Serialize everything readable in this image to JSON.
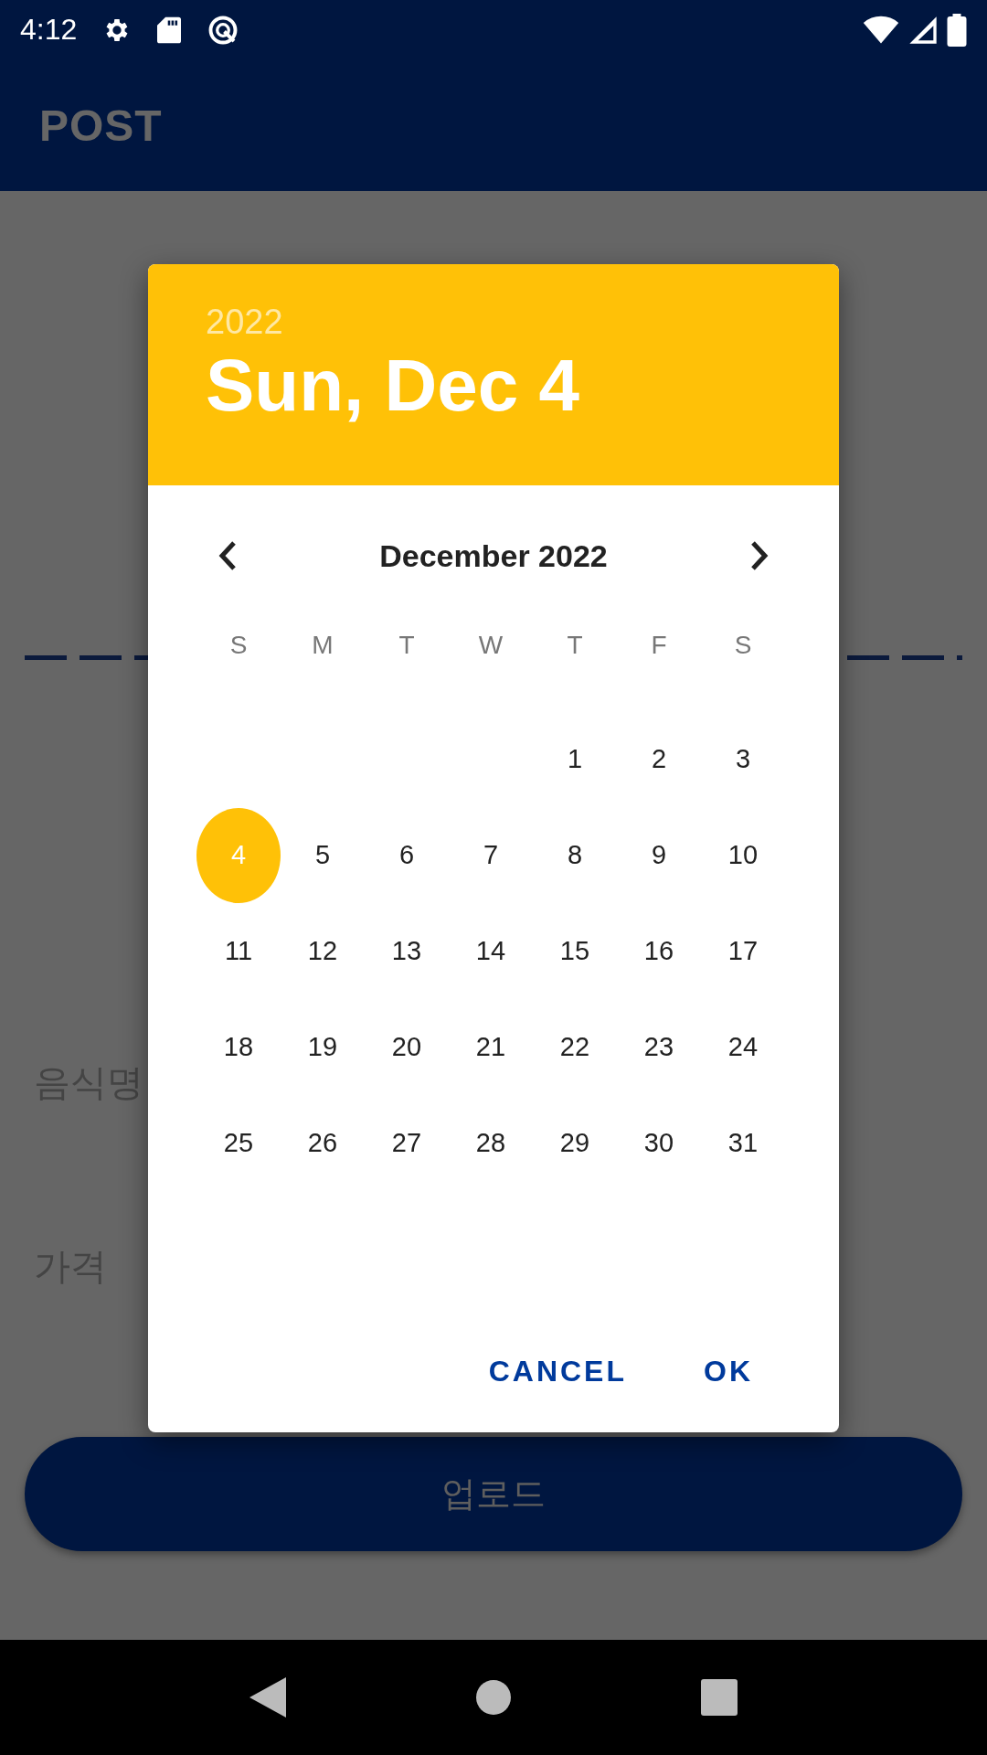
{
  "status_bar": {
    "time": "4:12"
  },
  "app_bar": {
    "title": "POST"
  },
  "form": {
    "labels": [
      "음식명",
      "가격"
    ],
    "submit_button": "업로드"
  },
  "date_picker": {
    "year": "2022",
    "date": "Sun, Dec 4",
    "month": "December 2022",
    "weekdays": [
      "S",
      "M",
      "T",
      "W",
      "T",
      "F",
      "S"
    ],
    "weeks": [
      [
        {
          "kind": "blank"
        },
        {
          "kind": "blank"
        },
        {
          "kind": "blank"
        },
        {
          "kind": "blank"
        },
        {
          "kind": "day",
          "label": "1",
          "selected": false
        },
        {
          "kind": "day",
          "label": "2",
          "selected": false
        },
        {
          "kind": "day",
          "label": "3",
          "selected": false
        }
      ],
      [
        {
          "kind": "day",
          "label": "4",
          "selected": true
        },
        {
          "kind": "day",
          "label": "5",
          "selected": false
        },
        {
          "kind": "day",
          "label": "6",
          "selected": false
        },
        {
          "kind": "day",
          "label": "7",
          "selected": false
        },
        {
          "kind": "day",
          "label": "8",
          "selected": false
        },
        {
          "kind": "day",
          "label": "9",
          "selected": false
        },
        {
          "kind": "day",
          "label": "10",
          "selected": false
        }
      ],
      [
        {
          "kind": "day",
          "label": "11",
          "selected": false
        },
        {
          "kind": "day",
          "label": "12",
          "selected": false
        },
        {
          "kind": "day",
          "label": "13",
          "selected": false
        },
        {
          "kind": "day",
          "label": "14",
          "selected": false
        },
        {
          "kind": "day",
          "label": "15",
          "selected": false
        },
        {
          "kind": "day",
          "label": "16",
          "selected": false
        },
        {
          "kind": "day",
          "label": "17",
          "selected": false
        }
      ],
      [
        {
          "kind": "day",
          "label": "18",
          "selected": false
        },
        {
          "kind": "day",
          "label": "19",
          "selected": false
        },
        {
          "kind": "day",
          "label": "20",
          "selected": false
        },
        {
          "kind": "day",
          "label": "21",
          "selected": false
        },
        {
          "kind": "day",
          "label": "22",
          "selected": false
        },
        {
          "kind": "day",
          "label": "23",
          "selected": false
        },
        {
          "kind": "day",
          "label": "24",
          "selected": false
        }
      ],
      [
        {
          "kind": "day",
          "label": "25",
          "selected": false
        },
        {
          "kind": "day",
          "label": "26",
          "selected": false
        },
        {
          "kind": "day",
          "label": "27",
          "selected": false
        },
        {
          "kind": "day",
          "label": "28",
          "selected": false
        },
        {
          "kind": "day",
          "label": "29",
          "selected": false
        },
        {
          "kind": "day",
          "label": "30",
          "selected": false
        },
        {
          "kind": "day",
          "label": "31",
          "selected": false
        }
      ]
    ],
    "actions": [
      "CANCEL",
      "OK"
    ]
  }
}
